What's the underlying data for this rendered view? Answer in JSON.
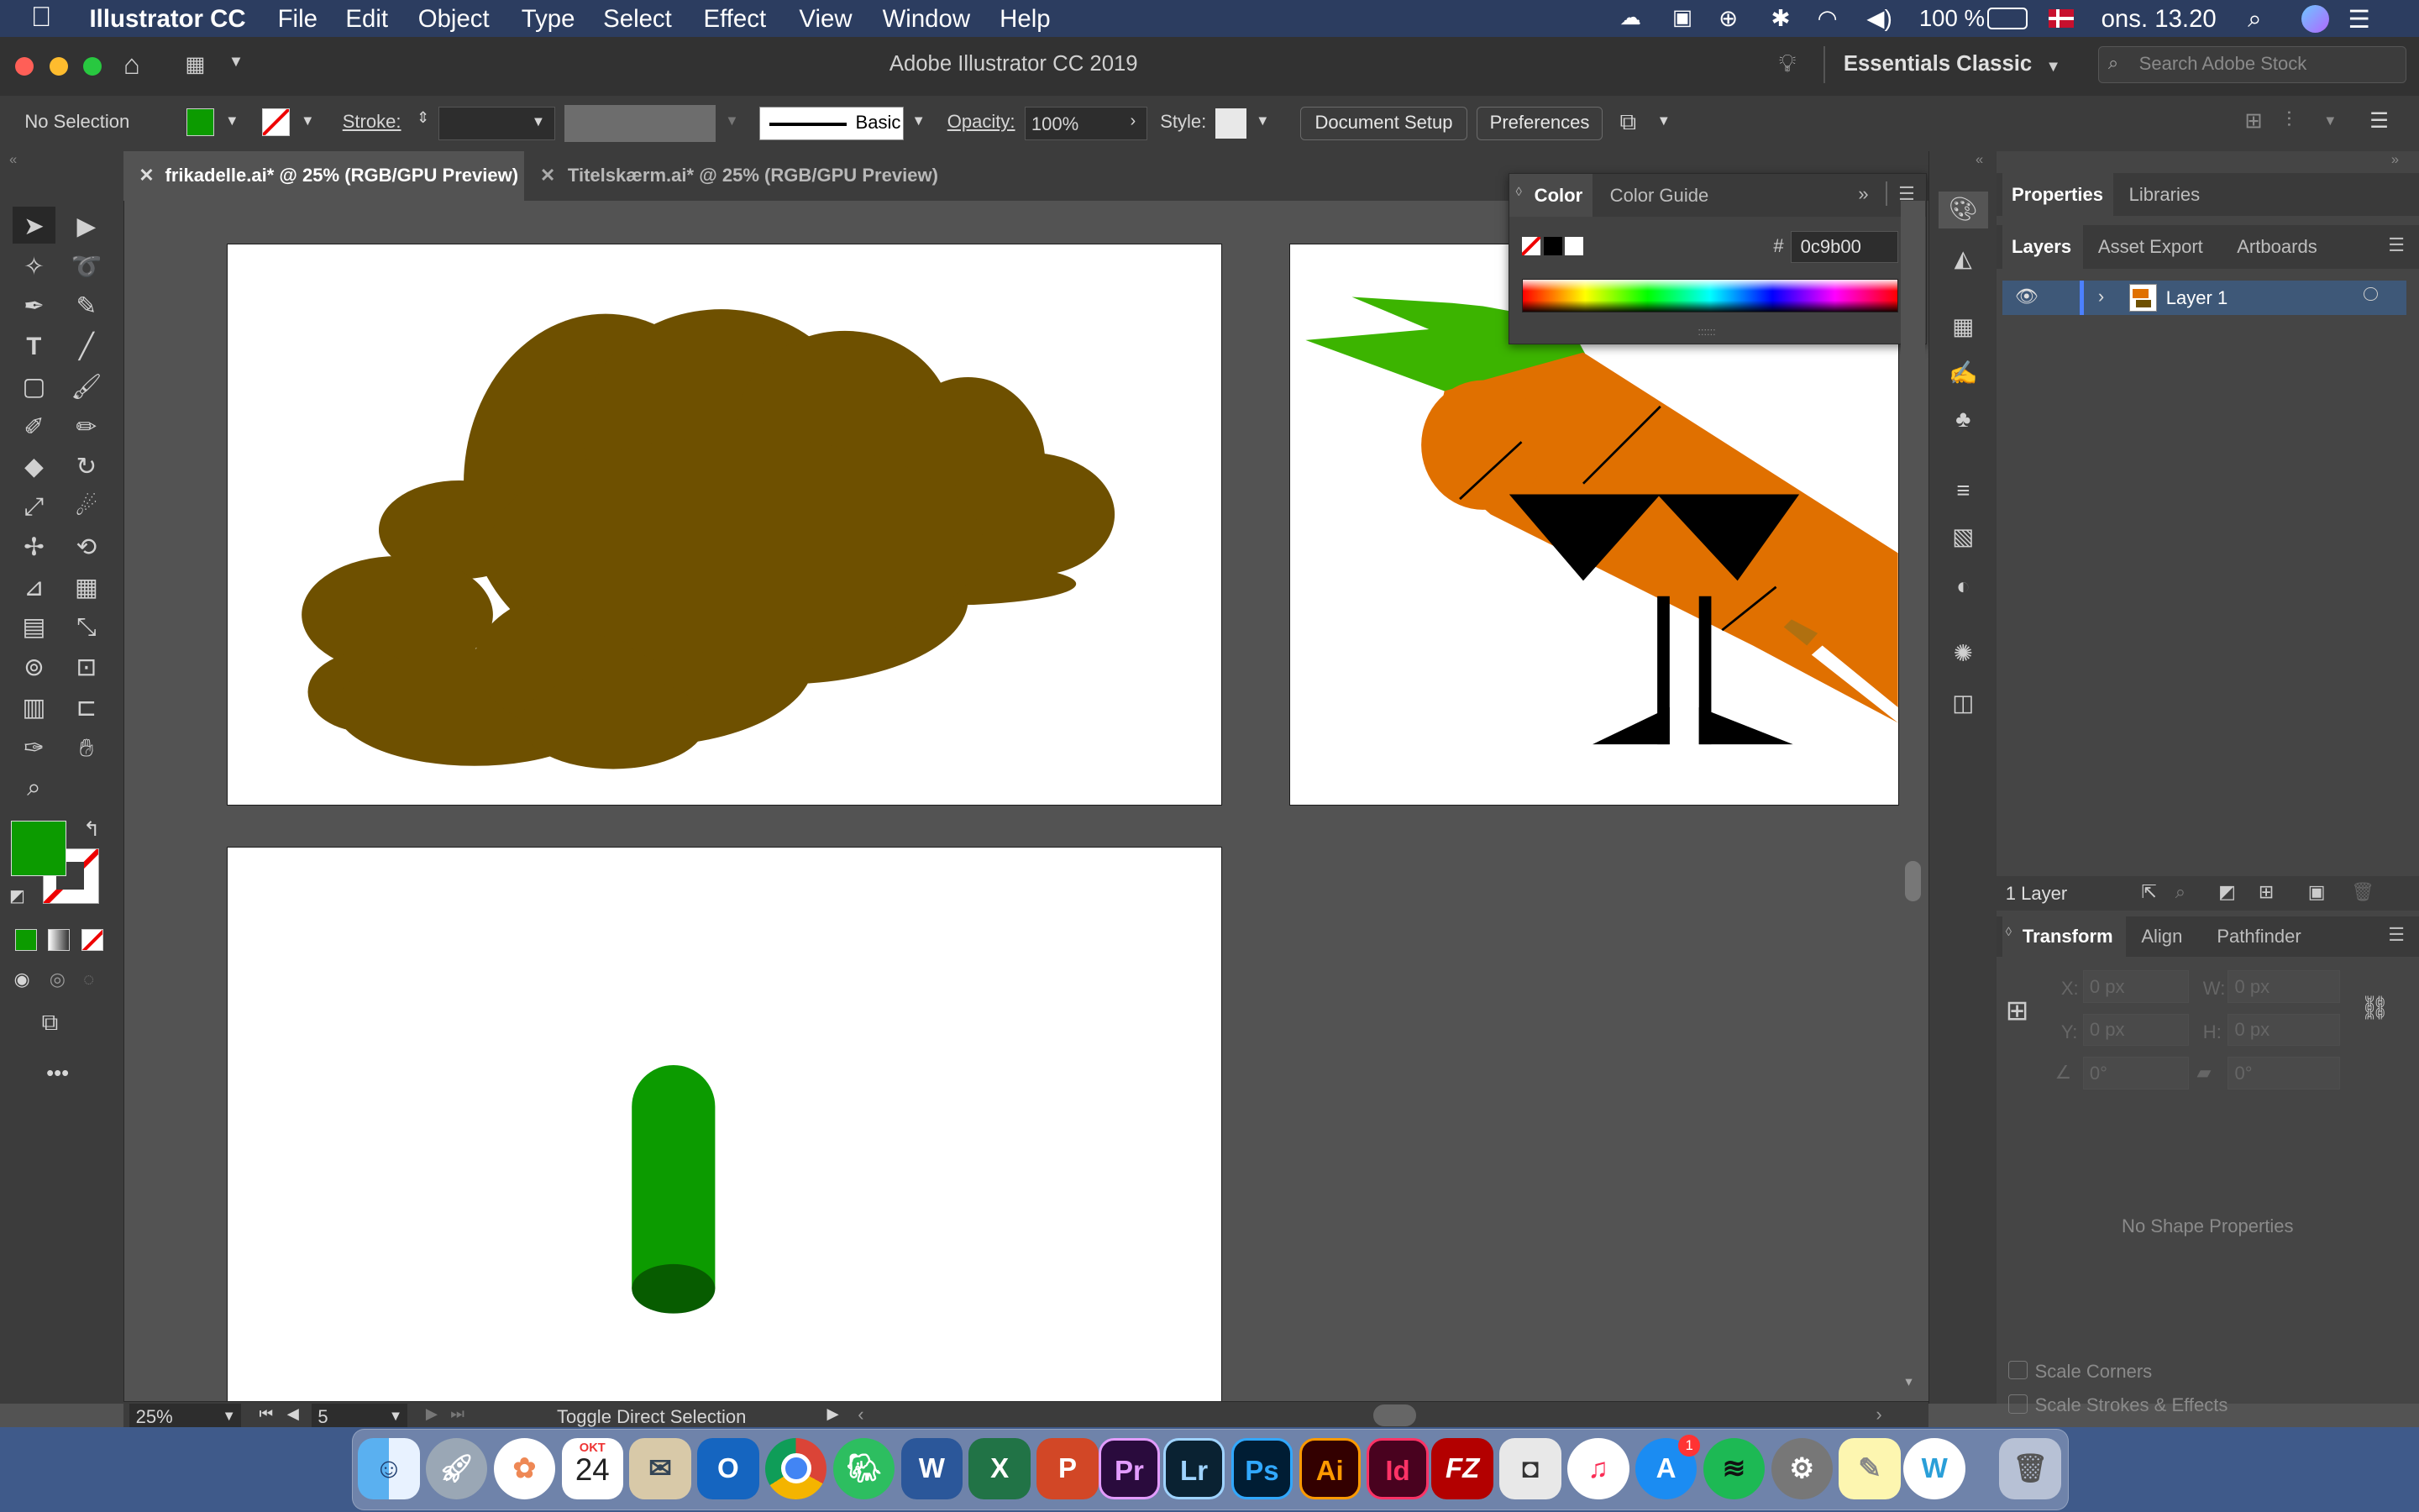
{
  "menubar": {
    "app_name": "Illustrator CC",
    "menus": [
      "File",
      "Edit",
      "Object",
      "Type",
      "Select",
      "Effect",
      "View",
      "Window",
      "Help"
    ],
    "battery": "100 %",
    "clock": "ons. 13.20"
  },
  "titlebar": {
    "title": "Adobe Illustrator CC 2019",
    "workspace": "Essentials Classic",
    "search_placeholder": "Search Adobe Stock"
  },
  "controlbar": {
    "selection": "No Selection",
    "fill_color": "#0c9b00",
    "stroke_label": "Stroke:",
    "brush_label": "Basic",
    "opacity_label": "Opacity:",
    "opacity_value": "100%",
    "style_label": "Style:",
    "document_setup": "Document Setup",
    "preferences": "Preferences"
  },
  "tabs": [
    {
      "label": "frikadelle.ai* @ 25% (RGB/GPU Preview)",
      "active": true
    },
    {
      "label": "Titelskærm.ai* @ 25% (RGB/GPU Preview)",
      "active": false
    }
  ],
  "color_panel": {
    "tab_color": "Color",
    "tab_guide": "Color Guide",
    "hex_symbol": "#",
    "hex_value": "0c9b00"
  },
  "right_panels": {
    "tabs_top": [
      "Properties",
      "Libraries"
    ],
    "tabs_layers": [
      "Layers",
      "Asset Export",
      "Artboards"
    ],
    "layer_name": "Layer 1",
    "layer_count": "1 Layer",
    "tabs_transform": [
      "Transform",
      "Align",
      "Pathfinder"
    ],
    "x_label": "X:",
    "y_label": "Y:",
    "w_label": "W:",
    "h_label": "H:",
    "x_value": "0 px",
    "y_value": "0 px",
    "w_value": "0 px",
    "h_value": "0 px",
    "rotate_value": "0°",
    "shear_value": "0°",
    "no_shape": "No Shape Properties",
    "scale_corners": "Scale Corners",
    "scale_strokes": "Scale Strokes & Effects"
  },
  "statusbar": {
    "zoom": "25%",
    "artboard_num": "5",
    "status_text": "Toggle Direct Selection"
  },
  "artwork": {
    "meatball_color": "#6e5000",
    "carrot_color": "#e07000",
    "leaf_color": "#3cb400",
    "pickle_color": "#0c9b00",
    "pickle_dark": "#075c00"
  },
  "dock": {
    "calendar_month": "OKT",
    "calendar_day": "24",
    "appstore_badge": "1",
    "apps": [
      "Finder",
      "Launchpad",
      "Photos",
      "Calendar",
      "Mail",
      "Outlook",
      "Chrome",
      "Evernote",
      "Word",
      "Excel",
      "PowerPoint",
      "Premiere",
      "Lightroom",
      "Photoshop",
      "Illustrator",
      "InDesign",
      "FileZilla",
      "Remote",
      "Music",
      "App Store",
      "Spotify",
      "System Preferences",
      "Notes",
      "Writer",
      "Trash"
    ],
    "labels": {
      "word": "W",
      "excel": "X",
      "powerpoint": "P",
      "premiere": "Pr",
      "lightroom": "Lr",
      "photoshop": "Ps",
      "illustrator": "Ai",
      "indesign": "Id",
      "filezilla": "FZ"
    }
  }
}
